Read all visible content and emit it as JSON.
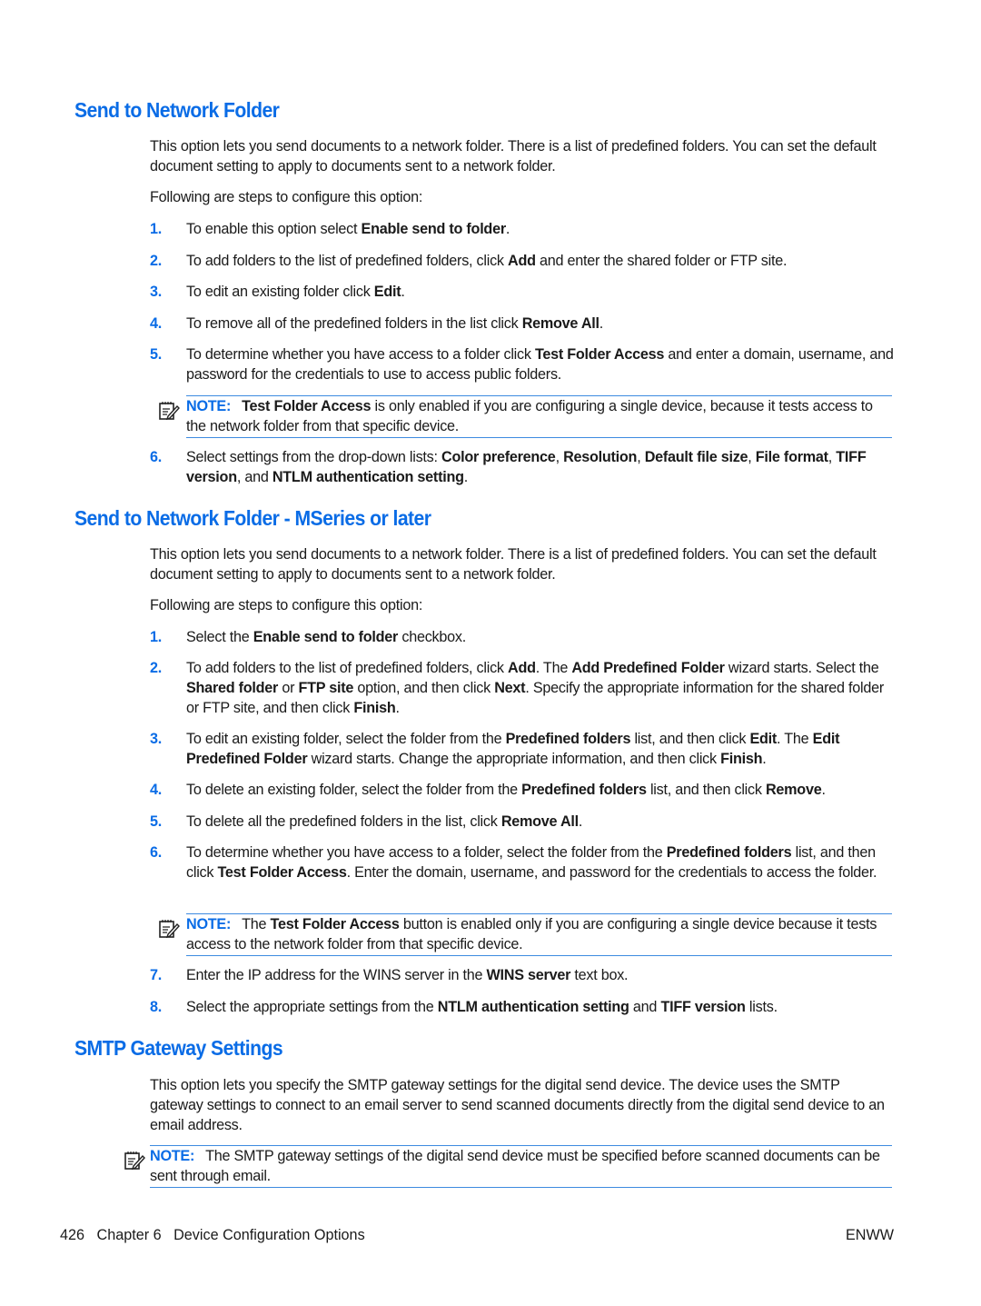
{
  "sections": [
    {
      "title": "Send to Network Folder",
      "intro": "This option lets you send documents to a network folder. There is a list of predefined folders. You can set the default document setting to apply to documents sent to a network folder.",
      "steps_intro": "Following are steps to configure this option:",
      "steps": [
        {
          "num": "1.",
          "parts": [
            [
              "To enable this option select ",
              false
            ],
            [
              "Enable send to folder",
              true
            ],
            [
              ".",
              false
            ]
          ]
        },
        {
          "num": "2.",
          "parts": [
            [
              "To add folders to the list of predefined folders, click ",
              false
            ],
            [
              "Add",
              true
            ],
            [
              " and enter the shared folder or FTP site.",
              false
            ]
          ]
        },
        {
          "num": "3.",
          "parts": [
            [
              "To edit an existing folder click ",
              false
            ],
            [
              "Edit",
              true
            ],
            [
              ".",
              false
            ]
          ]
        },
        {
          "num": "4.",
          "parts": [
            [
              "To remove all of the predefined folders in the list click ",
              false
            ],
            [
              "Remove All",
              true
            ],
            [
              ".",
              false
            ]
          ]
        },
        {
          "num": "5.",
          "parts": [
            [
              "To determine whether you have access to a folder click ",
              false
            ],
            [
              "Test Folder Access",
              true
            ],
            [
              " and enter a domain, username, and password for the credentials to use to access public folders.",
              false
            ]
          ]
        },
        {
          "num": "6.",
          "parts": [
            [
              "Select settings from the drop-down lists: ",
              false
            ],
            [
              "Color preference",
              true
            ],
            [
              ", ",
              false
            ],
            [
              "Resolution",
              true
            ],
            [
              ", ",
              false
            ],
            [
              "Default file size",
              true
            ],
            [
              ", ",
              false
            ],
            [
              "File format",
              true
            ],
            [
              ", ",
              false
            ],
            [
              "TIFF version",
              true
            ],
            [
              ", and ",
              false
            ],
            [
              "NTLM authentication setting",
              true
            ],
            [
              ".",
              false
            ]
          ]
        }
      ],
      "note": {
        "label": "NOTE:",
        "parts": [
          [
            "Test Folder Access",
            true
          ],
          [
            " is only enabled if you are configuring a single device, because it tests access to the network folder from that specific device.",
            false
          ]
        ]
      }
    },
    {
      "title": "Send to Network Folder - MSeries or later",
      "intro": "This option lets you send documents to a network folder. There is a list of predefined folders. You can set the default document setting to apply to documents sent to a network folder.",
      "steps_intro": "Following are steps to configure this option:",
      "steps": [
        {
          "num": "1.",
          "parts": [
            [
              "Select the ",
              false
            ],
            [
              "Enable send to folder",
              true
            ],
            [
              " checkbox.",
              false
            ]
          ]
        },
        {
          "num": "2.",
          "parts": [
            [
              "To add folders to the list of predefined folders, click ",
              false
            ],
            [
              "Add",
              true
            ],
            [
              ". The ",
              false
            ],
            [
              "Add Predefined Folder",
              true
            ],
            [
              " wizard starts. Select the ",
              false
            ],
            [
              "Shared folder",
              true
            ],
            [
              " or ",
              false
            ],
            [
              "FTP site",
              true
            ],
            [
              " option, and then click ",
              false
            ],
            [
              "Next",
              true
            ],
            [
              ". Specify the appropriate information for the shared folder or FTP site, and then click ",
              false
            ],
            [
              "Finish",
              true
            ],
            [
              ".",
              false
            ]
          ]
        },
        {
          "num": "3.",
          "parts": [
            [
              "To edit an existing folder, select the folder from the ",
              false
            ],
            [
              "Predefined folders",
              true
            ],
            [
              " list, and then click ",
              false
            ],
            [
              "Edit",
              true
            ],
            [
              ". The ",
              false
            ],
            [
              "Edit Predefined Folder",
              true
            ],
            [
              " wizard starts. Change the appropriate information, and then click ",
              false
            ],
            [
              "Finish",
              true
            ],
            [
              ".",
              false
            ]
          ]
        },
        {
          "num": "4.",
          "parts": [
            [
              "To delete an existing folder, select the folder from the ",
              false
            ],
            [
              "Predefined folders",
              true
            ],
            [
              " list, and then click ",
              false
            ],
            [
              "Remove",
              true
            ],
            [
              ".",
              false
            ]
          ]
        },
        {
          "num": "5.",
          "parts": [
            [
              "To delete all the predefined folders in the list, click ",
              false
            ],
            [
              "Remove All",
              true
            ],
            [
              ".",
              false
            ]
          ]
        },
        {
          "num": "6.",
          "parts": [
            [
              "To determine whether you have access to a folder, select the folder from the ",
              false
            ],
            [
              "Predefined folders",
              true
            ],
            [
              " list, and then click ",
              false
            ],
            [
              "Test Folder Access",
              true
            ],
            [
              ". Enter the domain, username, and password for the credentials to access the folder.",
              false
            ]
          ]
        },
        {
          "num": "7.",
          "parts": [
            [
              "Enter the IP address for the WINS server in the ",
              false
            ],
            [
              "WINS server",
              true
            ],
            [
              " text box.",
              false
            ]
          ]
        },
        {
          "num": "8.",
          "parts": [
            [
              "Select the appropriate settings from the ",
              false
            ],
            [
              "NTLM authentication setting",
              true
            ],
            [
              " and ",
              false
            ],
            [
              "TIFF version",
              true
            ],
            [
              " lists.",
              false
            ]
          ]
        }
      ],
      "note": {
        "label": "NOTE:",
        "parts": [
          [
            "The ",
            false
          ],
          [
            "Test Folder Access",
            true
          ],
          [
            " button is enabled only if you are configuring a single device because it tests access to the network folder from that specific device.",
            false
          ]
        ]
      }
    },
    {
      "title": "SMTP Gateway Settings",
      "intro": "This option lets you specify the SMTP gateway settings for the digital send device. The device uses the SMTP gateway settings to connect to an email server to send scanned documents directly from the digital send device to an email address.",
      "note": {
        "label": "NOTE:",
        "parts": [
          [
            "The SMTP gateway settings of the digital send device must be specified before scanned documents can be sent through email.",
            false
          ]
        ]
      }
    }
  ],
  "footer": {
    "page_number": "426",
    "chapter": "Chapter 6",
    "chapter_title": "Device Configuration Options",
    "right_label": "ENWW"
  },
  "colors": {
    "accent": "#0a6ce6",
    "note_rule": "#3d8be0",
    "text": "#1a1a1a"
  },
  "icons": {
    "note": "note-pencil-icon"
  }
}
